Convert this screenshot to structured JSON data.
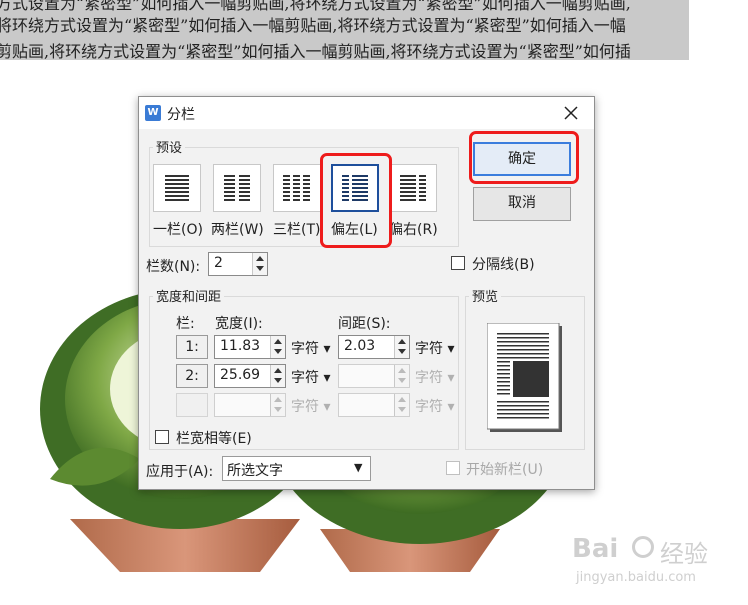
{
  "document": {
    "lines": [
      "方式设置为“紧密型”如何插入一幅剪贴画,将环绕方式设置为“紧密型”如何插入一幅剪贴画,",
      "将环绕方式设置为“紧密型”如何插入一幅剪贴画,将环绕方式设置为“紧密型”如何插入一幅",
      "剪贴画,将环绕方式设置为“紧密型”如何插入一幅剪贴画,将环绕方式设置为“紧密型”如何插"
    ]
  },
  "dialog": {
    "title": "分栏",
    "presets": {
      "group_label": "预设",
      "items": [
        {
          "label": "一栏(O)"
        },
        {
          "label": "两栏(W)"
        },
        {
          "label": "三栏(T)"
        },
        {
          "label": "偏左(L)"
        },
        {
          "label": "偏右(R)"
        }
      ],
      "selected": "偏左(L)"
    },
    "ok_label": "确定",
    "cancel_label": "取消",
    "num_columns": {
      "label": "栏数(N):",
      "value": "2"
    },
    "separator": {
      "label": "分隔线(B)",
      "checked": false
    },
    "width_spacing": {
      "group_label": "宽度和间距",
      "col_header": "栏:",
      "width_header": "宽度(I):",
      "spacing_header": "间距(S):",
      "unit": "字符",
      "rows": [
        {
          "col": "1:",
          "width": "11.83",
          "spacing": "2.03"
        },
        {
          "col": "2:",
          "width": "25.69",
          "spacing": ""
        },
        {
          "col": "",
          "width": "",
          "spacing": ""
        }
      ]
    },
    "equal_width": {
      "label": "栏宽相等(E)",
      "checked": false
    },
    "preview_label": "预览",
    "apply_to": {
      "label": "应用于(A):",
      "value": "所选文字"
    },
    "new_column": {
      "label": "开始新栏(U)",
      "checked": false
    }
  },
  "watermark": {
    "brand": "Bai",
    "brand_cn": "经验",
    "url": "jingyan.baidu.com"
  }
}
